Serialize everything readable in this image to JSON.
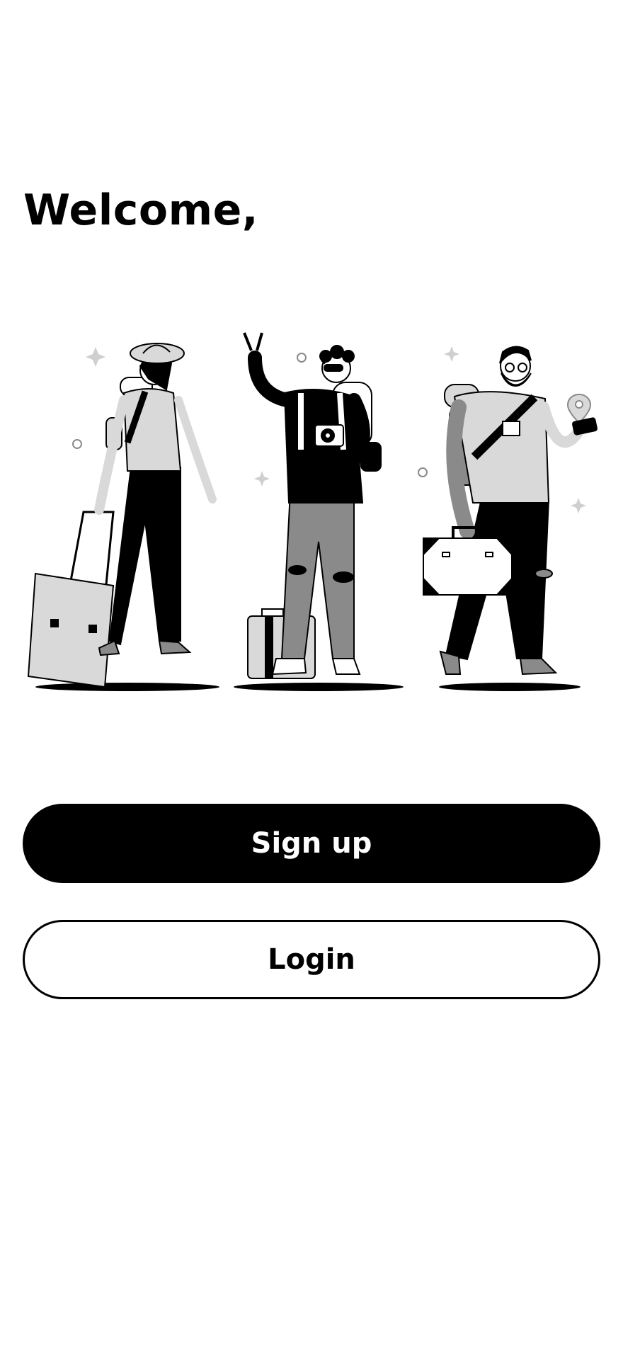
{
  "welcome": {
    "title": "Welcome,"
  },
  "illustration": {
    "subject": "three-travelers-illustration"
  },
  "actions": {
    "signup_label": "Sign up",
    "login_label": "Login"
  },
  "colors": {
    "primary": "#000000",
    "background": "#ffffff",
    "gray": "#8a8a8a",
    "light_gray": "#d9d9d9"
  }
}
